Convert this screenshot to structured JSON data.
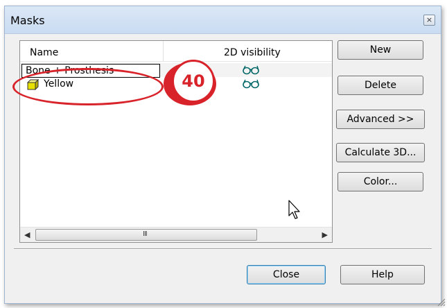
{
  "dialog": {
    "title": "Masks",
    "close_glyph": "×"
  },
  "list": {
    "columns": [
      "Name",
      "2D visibility"
    ],
    "rows": [
      {
        "name": "Bone + Prosthesis",
        "visibility_icon": "glasses-icon",
        "editing": true
      },
      {
        "name": "Yellow",
        "color_swatch": "#e8e000",
        "visibility_icon": "glasses-icon",
        "editing": false
      }
    ],
    "scroll_arrows": {
      "left": "◀",
      "right": "▶"
    },
    "scroll_grip": "III"
  },
  "buttons": {
    "new": "New",
    "delete": "Delete",
    "advanced": "Advanced >>",
    "calculate": "Calculate 3D...",
    "color": "Color...",
    "close": "Close",
    "help": "Help"
  },
  "annotation": {
    "step_number": "40",
    "accent_color": "#d8232a"
  }
}
